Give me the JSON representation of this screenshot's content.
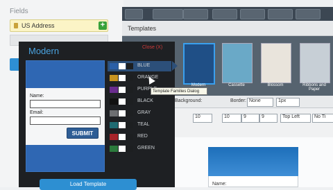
{
  "fields": {
    "title": "Fields",
    "items": [
      {
        "label": "US Address"
      }
    ]
  },
  "templates": {
    "header": "Templates",
    "thumbs": [
      {
        "label": "Modern",
        "selected": true
      },
      {
        "label": "Cassette"
      },
      {
        "label": "Blossom"
      },
      {
        "label": "Ribbons and Paper"
      }
    ]
  },
  "props": {
    "background_label": "Background:",
    "border_label": "Border:",
    "border_value": "None",
    "border_width": "1px",
    "size_a": "10",
    "size_b": "10",
    "size_c": "9",
    "size_d": "9",
    "align_value": "Top Left",
    "extra_value": "No Ti"
  },
  "dialog": {
    "title": "Modern",
    "close": "Close (X)",
    "form": {
      "name_label": "Name:",
      "email_label": "Email:",
      "submit": "SUBMIT"
    },
    "colors": [
      {
        "name": "BLUE",
        "c1": "#2b5fa6",
        "c2": "#ffffff",
        "c3": "#1d1f21",
        "selected": true
      },
      {
        "name": "ORANGE",
        "c1": "#c9941f",
        "c2": "#ffffff",
        "c3": "#1d1f21"
      },
      {
        "name": "PURPLE",
        "c1": "#6a2c8e",
        "c2": "#ffffff",
        "c3": "#1d1f21"
      },
      {
        "name": "BLACK",
        "c1": "#111111",
        "c2": "#ffffff",
        "c3": "#1d1f21"
      },
      {
        "name": "GRAY",
        "c1": "#6d6f72",
        "c2": "#ffffff",
        "c3": "#1d1f21"
      },
      {
        "name": "TEAL",
        "c1": "#1f6b72",
        "c2": "#ffffff",
        "c3": "#1d1f21"
      },
      {
        "name": "RED",
        "c1": "#a7242a",
        "c2": "#ffffff",
        "c3": "#1d1f21"
      },
      {
        "name": "GREEN",
        "c1": "#2b7a3c",
        "c2": "#ffffff",
        "c3": "#1d1f21"
      }
    ],
    "load_button": "Load Template"
  },
  "tooltip": "Template Families Dialog",
  "canvas": {
    "name_label": "Name:"
  }
}
